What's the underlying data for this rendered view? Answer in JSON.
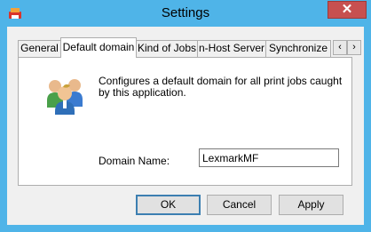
{
  "window": {
    "title": "Settings",
    "close_symbol": "✕",
    "app_icon": "app-icon",
    "accent_color": "#4fb4e8"
  },
  "tabs": {
    "items": [
      {
        "label": "General",
        "active": false
      },
      {
        "label": "Default domain",
        "active": true
      },
      {
        "label": "Kind of Jobs",
        "active": false
      },
      {
        "label": "n-Host Server",
        "active": false
      },
      {
        "label": "Synchronize",
        "active": false
      }
    ],
    "scroll_left": "‹",
    "scroll_right": "›"
  },
  "panel": {
    "icon": "users-icon",
    "description": "Configures a default domain for all print jobs caught by this application.",
    "domain_label": "Domain Name:",
    "domain_value": "LexmarkMF"
  },
  "buttons": {
    "ok": "OK",
    "cancel": "Cancel",
    "apply": "Apply"
  }
}
